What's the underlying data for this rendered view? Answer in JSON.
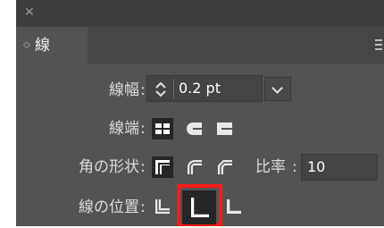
{
  "panel": {
    "tab_label": "線",
    "icons": {
      "close": "close-x-icon",
      "tab_toggle": "double-arrow-icon",
      "menu": "hamburger-menu-icon"
    }
  },
  "weight": {
    "label": "線幅",
    "value": "0.2 pt"
  },
  "cap": {
    "label": "線端",
    "options": [
      "butt-cap-icon",
      "round-cap-icon",
      "projecting-cap-icon"
    ]
  },
  "corner": {
    "label": "角の形状",
    "options": [
      "miter-join-icon",
      "round-join-icon",
      "bevel-join-icon"
    ],
    "limit_label": "比率",
    "limit_value": "10"
  },
  "align": {
    "label": "線の位置",
    "options": [
      "align-center-icon",
      "align-inside-icon",
      "align-outside-icon"
    ],
    "selected_index": 1
  },
  "colors": {
    "panel_bg": "#535353",
    "highlight": "#ff1a1a",
    "selected_icon_bg": "#262626"
  }
}
